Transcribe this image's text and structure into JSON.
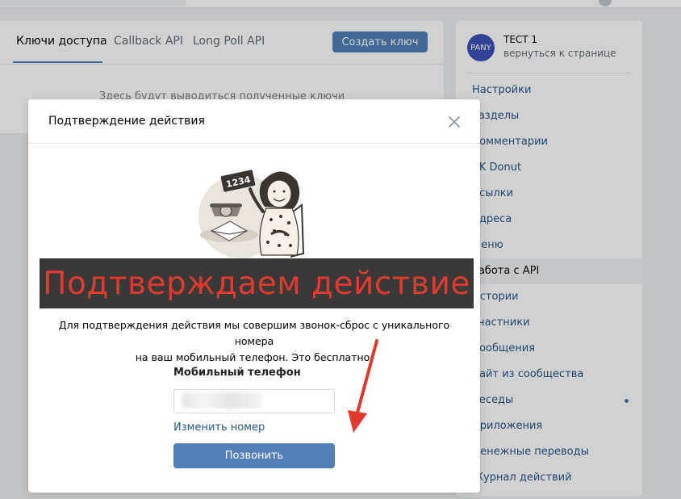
{
  "background": {
    "tabs": [
      {
        "label": "Ключи доступа",
        "active": true
      },
      {
        "label": "Callback API",
        "active": false
      },
      {
        "label": "Long Poll API",
        "active": false
      }
    ],
    "create_key_label": "Создать ключ",
    "empty_note": "Здесь будут выводиться полученные ключи",
    "group": {
      "avatar_text": "PANY",
      "name": "ТЕСТ 1",
      "back_link": "вернуться к странице"
    },
    "menu": [
      {
        "label": "Настройки",
        "active": false
      },
      {
        "label": "Разделы",
        "active": false
      },
      {
        "label": "Комментарии",
        "active": false
      },
      {
        "label": "VK Donut",
        "active": false
      },
      {
        "label": "Ссылки",
        "active": false
      },
      {
        "label": "Адреса",
        "active": false
      },
      {
        "label": "Меню",
        "active": false
      },
      {
        "label": "Работа с API",
        "active": true
      },
      {
        "label": "Истории",
        "active": false
      },
      {
        "label": "Участники",
        "active": false
      },
      {
        "label": "Сообщения",
        "active": false
      },
      {
        "label": "Сайт из сообщества",
        "active": false
      },
      {
        "label": "Беседы",
        "active": false,
        "dot": true
      },
      {
        "label": "Приложения",
        "active": false
      },
      {
        "label": "Денежные переводы",
        "active": false
      },
      {
        "label": "Журнал действий",
        "active": false
      }
    ]
  },
  "modal": {
    "title": "Подтверждение действия",
    "illustration_number": "1234",
    "description_line1": "Для подтверждения действия мы совершим звонок-сброс с уникального номера",
    "description_line2": "на ваш мобильный телефон. Это бесплатно.",
    "phone_label": "Мобильный телефон",
    "phone_value": "",
    "change_number_label": "Изменить номер",
    "call_button_label": "Позвонить"
  },
  "annotation": {
    "banner_text": "Подтверждаем действие",
    "arrow_color": "#e03a2f"
  },
  "colors": {
    "accent": "#5181b8",
    "link": "#2a5885",
    "banner_text": "#e03a2f"
  }
}
